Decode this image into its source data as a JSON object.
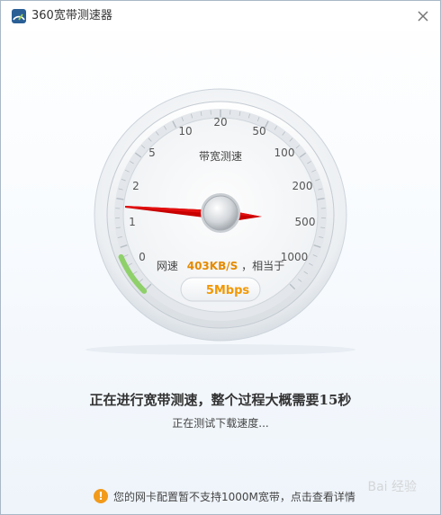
{
  "window": {
    "title": "360宽带测速器"
  },
  "gauge": {
    "title": "带宽测速",
    "scale_labels": [
      "0",
      "1",
      "2",
      "5",
      "10",
      "20",
      "50",
      "100",
      "200",
      "500",
      "1000"
    ],
    "needle_value_label": "500",
    "speed_prefix": "网速",
    "speed_value": "403KB/S",
    "speed_suffix": "，相当于",
    "mbps": "5Mbps"
  },
  "status": {
    "main": "正在进行宽带测速，整个过程大概需要15秒",
    "sub": "正在测试下载速度..."
  },
  "notice": {
    "text": "您的网卡配置暂不支持1000M宽带，点击查看详情"
  },
  "watermark": {
    "text": "Bai 经验"
  },
  "colors": {
    "needle": "#c80000",
    "speed_value": "#e58a00",
    "progress_arc": "#8fd06a",
    "warning": "#f29a1a"
  }
}
